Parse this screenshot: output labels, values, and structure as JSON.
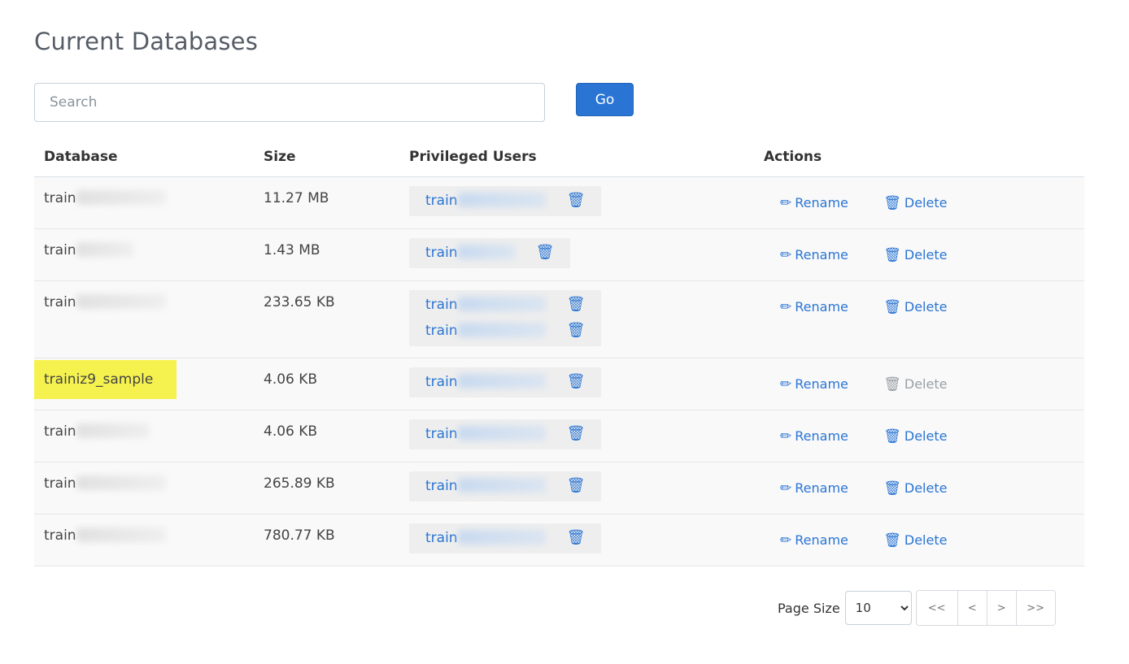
{
  "page": {
    "title": "Current Databases"
  },
  "search": {
    "placeholder": "Search",
    "value": "",
    "go_label": "Go"
  },
  "table": {
    "headers": {
      "database": "Database",
      "size": "Size",
      "users": "Privileged Users",
      "actions": "Actions"
    },
    "rows": [
      {
        "db_prefix": "train",
        "size": "11.27 MB",
        "users": [
          "train"
        ]
      },
      {
        "db_prefix": "train",
        "size": "1.43 MB",
        "users": [
          "train"
        ]
      },
      {
        "db_prefix": "train",
        "size": "233.65 KB",
        "users": [
          "train",
          "train"
        ]
      },
      {
        "db_name": "trainiz9_sample",
        "size": "4.06 KB",
        "users": [
          "train"
        ],
        "delete_disabled": true
      },
      {
        "db_prefix": "train",
        "size": "4.06 KB",
        "users": [
          "train"
        ]
      },
      {
        "db_prefix": "train",
        "size": "265.89 KB",
        "users": [
          "train"
        ]
      },
      {
        "db_prefix": "train",
        "size": "780.77 KB",
        "users": [
          "train"
        ]
      }
    ],
    "actions": {
      "rename": "Rename",
      "delete": "Delete"
    }
  },
  "pagination": {
    "page_size_label": "Page Size",
    "page_size": "10",
    "first": "<<",
    "prev": "<",
    "next": ">",
    "last": ">>"
  },
  "colors": {
    "accent": "#2a75d3",
    "highlight": "#f5f24f"
  },
  "icons": {
    "rename": "pencil-icon",
    "delete": "trash-icon"
  }
}
